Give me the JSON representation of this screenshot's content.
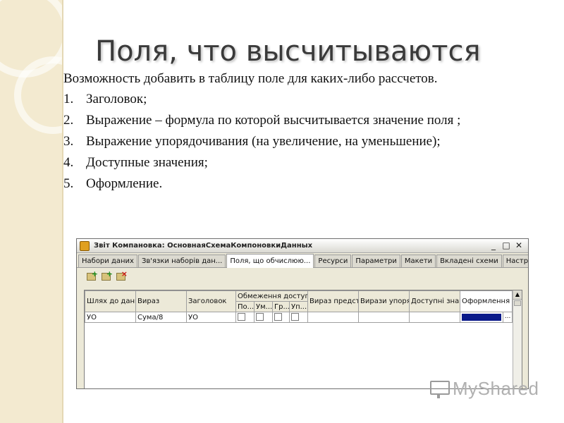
{
  "slide": {
    "title": "Поля, что высчитываются",
    "intro": "Возможность добавить в таблицу поле для каких-либо рассчетов.",
    "points": [
      {
        "num": "1.",
        "text": "Заголовок;"
      },
      {
        "num": "2.",
        "text": "Выражение – формула по которой высчитывается значение поля ;"
      },
      {
        "num": "3.",
        "text": "Выражение упорядочивания (на увеличение, на уменьшение);"
      },
      {
        "num": "4.",
        "text": "Доступные значения;"
      },
      {
        "num": "5.",
        "text": "Оформление."
      }
    ]
  },
  "window": {
    "title": "Звіт Компановка: ОсновнаяСхемаКомпоновкиДанных",
    "controls": [
      "_",
      "□",
      "✕"
    ],
    "tabs": [
      "Набори даних",
      "Зв'язки наборів дан...",
      "Поля, що обчислюю...",
      "Ресурси",
      "Параметри",
      "Макети",
      "Вкладені схеми",
      "Настройки"
    ],
    "active_tab": 2,
    "toolbar_icons": [
      "add-field-icon",
      "add-copy-icon",
      "delete-field-icon"
    ],
    "grid": {
      "headers": [
        "Шлях до даних",
        "Вираз",
        "Заголовок",
        "Обмеження доступ...",
        "Вираз представле...",
        "Вирази упорядкуван...",
        "Доступні значення",
        "Оформлення"
      ],
      "subheaders": [
        "По...",
        "Ум...",
        "Гр...",
        "Уп..."
      ],
      "rows": [
        {
          "path": "УО",
          "expression": "Сума/8",
          "title": "УО"
        }
      ],
      "format_button": "..."
    }
  },
  "watermark": "MyShared",
  "colors": {
    "side_band": "#f3ead0",
    "format_swatch": "#0a1a8a"
  }
}
